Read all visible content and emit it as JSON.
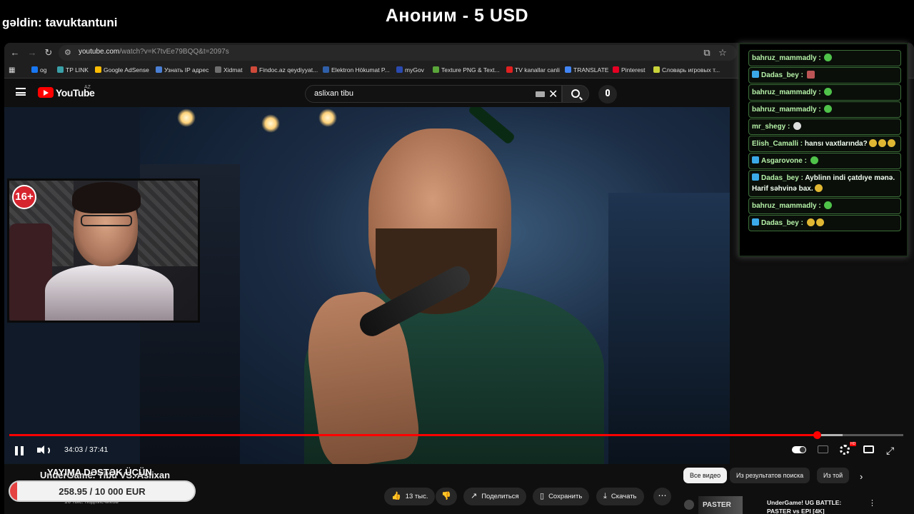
{
  "overlay": {
    "join_message": "gəldin: tavuktantuni",
    "donation_banner": "Аноним - 5 USD",
    "support_label": "YAYIMA DƏSTƏK ÜÇÜN",
    "goal_text": "258.95 / 10 000 EUR",
    "goal_progress": 0.0259,
    "age_rating": "16+"
  },
  "browser": {
    "url_host": "youtube.com",
    "url_path": "/watch?v=K7tvEe79BQQ&t=2097s",
    "bookmarks": [
      {
        "label": "og",
        "color": "#1877f2"
      },
      {
        "label": "TP LINK",
        "color": "#3aa0a8"
      },
      {
        "label": "Google AdSense",
        "color": "#fbbc04"
      },
      {
        "label": "Узнать IP адрес",
        "color": "#4a7fd4"
      },
      {
        "label": "Xidmat",
        "color": "#6f6f6f"
      },
      {
        "label": "Findoc.az qeydiyyat...",
        "color": "#d04a3a"
      },
      {
        "label": "Elektron Hökumat P...",
        "color": "#2f5fa8"
      },
      {
        "label": "myGov",
        "color": "#2a4ab0"
      },
      {
        "label": "Texture PNG & Text...",
        "color": "#5aa63a"
      },
      {
        "label": "TV kanallar canli",
        "color": "#e02020"
      },
      {
        "label": "TRANSLATE",
        "color": "#4285f4"
      },
      {
        "label": "Pinterest",
        "color": "#e60023"
      },
      {
        "label": "Словарь игровых т...",
        "color": "#c9d33a"
      }
    ]
  },
  "youtube": {
    "logo_text": "YouTube",
    "region": "AZ",
    "search_query": "aslixan tibu",
    "time_display": "34:03 / 37:41",
    "played_fraction": 0.903,
    "buffered_fraction": 0.932,
    "video_title": "UnderGame. Tibu VS. Aslixan",
    "subscribers": "16 тыс. подписчиков",
    "actions": {
      "like_count": "13 тыс.",
      "share": "Поделиться",
      "save": "Сохранить",
      "download": "Скачать"
    },
    "chips": [
      "Все видео",
      "Из результатов поиска",
      "Из той"
    ],
    "recommended": {
      "thumb_text": "PASTER",
      "title": "UnderGame! UG BATTLE: PASTER vs EPI [4K]"
    }
  },
  "chat": {
    "messages": [
      {
        "user": "bahruz_mammadly",
        "text": "",
        "platform": false,
        "emotes": [
          "green"
        ]
      },
      {
        "user": "Dadas_bey",
        "text": "",
        "platform": true,
        "emotes": [
          "red"
        ]
      },
      {
        "user": "bahruz_mammadly",
        "text": "",
        "platform": false,
        "emotes": [
          "green"
        ]
      },
      {
        "user": "bahruz_mammadly",
        "text": "",
        "platform": false,
        "emotes": [
          "green"
        ]
      },
      {
        "user": "mr_shegy",
        "text": "",
        "platform": false,
        "emotes": [
          "white"
        ]
      },
      {
        "user": "Elish_Camalli",
        "text": "hansı vaxtlarında?",
        "platform": false,
        "emotes": [
          "yellow",
          "yellow",
          "yellow"
        ]
      },
      {
        "user": "Asgarovone",
        "text": "",
        "platform": true,
        "emotes": [
          "green"
        ]
      },
      {
        "user": "Dadas_bey",
        "text": "Ayblinn indi çatdıye mənə. Harif səhvinə bax.",
        "platform": true,
        "emotes": [
          "yellow"
        ]
      },
      {
        "user": "bahruz_mammadly",
        "text": "",
        "platform": false,
        "emotes": [
          "green"
        ]
      },
      {
        "user": "Dadas_bey",
        "text": "",
        "platform": true,
        "emotes": [
          "yellow",
          "yellow"
        ]
      }
    ]
  },
  "colors": {
    "youtube_red": "#ff0000",
    "chat_border": "#3c6e38",
    "goal_fill": "#e54242"
  }
}
